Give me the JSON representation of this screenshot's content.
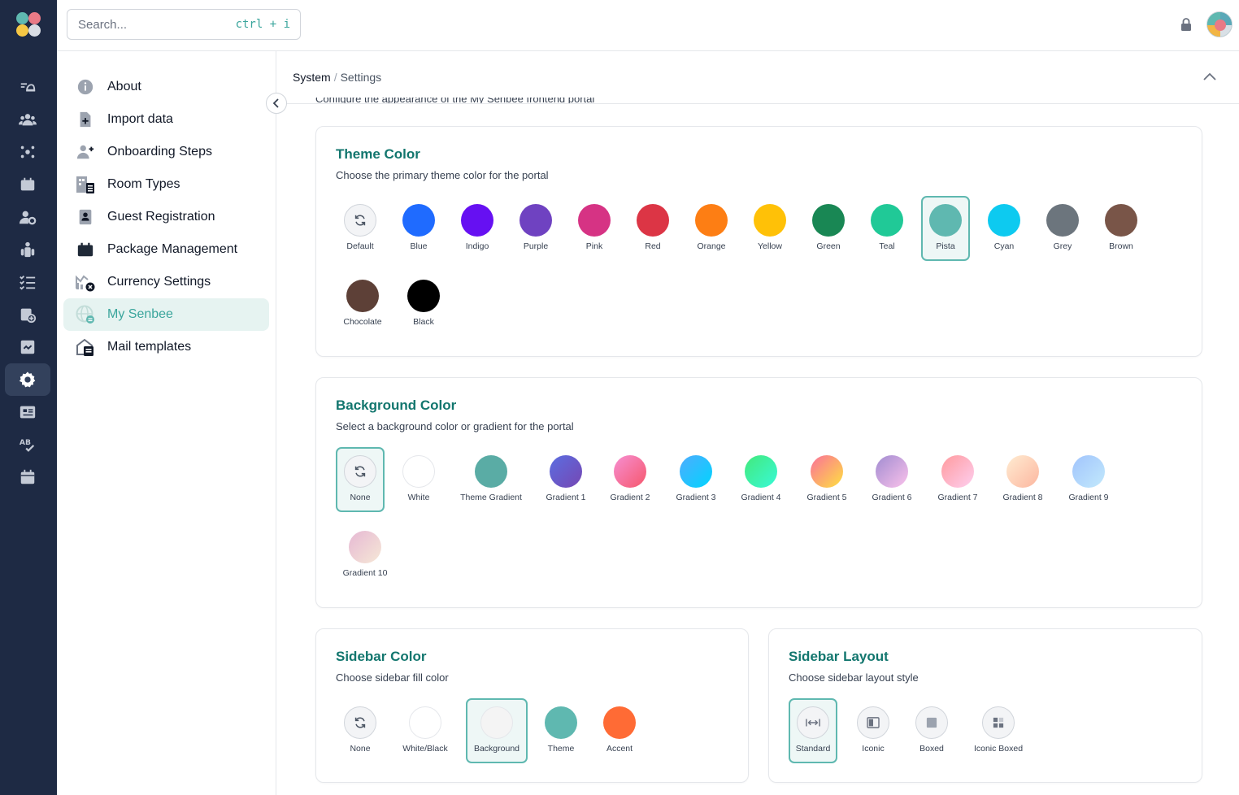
{
  "search": {
    "placeholder": "Search...",
    "shortcut": "ctrl + i"
  },
  "breadcrumb": {
    "parent": "System",
    "separator": "/",
    "current": "Settings"
  },
  "clipped_description": "Configure the appearance of the My Senbee frontend portal",
  "nav": [
    {
      "label": "About",
      "icon": "info-icon"
    },
    {
      "label": "Import data",
      "icon": "file-plus-icon"
    },
    {
      "label": "Onboarding Steps",
      "icon": "user-plus-icon"
    },
    {
      "label": "Room Types",
      "icon": "building-list-icon"
    },
    {
      "label": "Guest Registration",
      "icon": "id-card-icon"
    },
    {
      "label": "Package Management",
      "icon": "package-icon"
    },
    {
      "label": "Currency Settings",
      "icon": "currency-chart-icon"
    },
    {
      "label": "My Senbee",
      "icon": "globe-icon",
      "active": true
    },
    {
      "label": "Mail templates",
      "icon": "mail-template-icon"
    }
  ],
  "theme": {
    "title": "Theme Color",
    "subtitle": "Choose the primary theme color for the portal",
    "options": [
      {
        "name": "Default",
        "color": "reset"
      },
      {
        "name": "Blue",
        "color": "#1f6bff"
      },
      {
        "name": "Indigo",
        "color": "#6610f2"
      },
      {
        "name": "Purple",
        "color": "#6f42c1"
      },
      {
        "name": "Pink",
        "color": "#d63384"
      },
      {
        "name": "Red",
        "color": "#dc3545"
      },
      {
        "name": "Orange",
        "color": "#fd7e14"
      },
      {
        "name": "Yellow",
        "color": "#ffc107"
      },
      {
        "name": "Green",
        "color": "#198754"
      },
      {
        "name": "Teal",
        "color": "#20c997"
      },
      {
        "name": "Pista",
        "color": "#5fb8b0",
        "selected": true
      },
      {
        "name": "Cyan",
        "color": "#0dcaf0"
      },
      {
        "name": "Grey",
        "color": "#6c757d"
      },
      {
        "name": "Brown",
        "color": "#795548"
      },
      {
        "name": "Chocolate",
        "color": "#5d4037"
      },
      {
        "name": "Black",
        "color": "#000000"
      }
    ]
  },
  "background": {
    "title": "Background Color",
    "subtitle": "Select a background color or gradient for the portal",
    "options": [
      {
        "name": "None",
        "color": "reset",
        "selected": true
      },
      {
        "name": "White",
        "color": "#ffffff"
      },
      {
        "name": "Theme Gradient",
        "color": "#5aaca5"
      },
      {
        "name": "Gradient 1",
        "color": "linear-gradient(135deg,#5b6ee1,#7647b3)"
      },
      {
        "name": "Gradient 2",
        "color": "linear-gradient(135deg,#f78fd2,#f5576c)"
      },
      {
        "name": "Gradient 3",
        "color": "linear-gradient(135deg,#4facfe,#00d4fe)"
      },
      {
        "name": "Gradient 4",
        "color": "linear-gradient(135deg,#43e97b,#38f9d7)"
      },
      {
        "name": "Gradient 5",
        "color": "linear-gradient(135deg,#fa709a,#fee140)"
      },
      {
        "name": "Gradient 6",
        "color": "linear-gradient(135deg,#a18cd1,#fbc2eb)"
      },
      {
        "name": "Gradient 7",
        "color": "linear-gradient(135deg,#ff9a9e,#fecfef)"
      },
      {
        "name": "Gradient 8",
        "color": "linear-gradient(135deg,#ffecd2,#fcb69f)"
      },
      {
        "name": "Gradient 9",
        "color": "linear-gradient(135deg,#a1c4fd,#c2e9fb)"
      },
      {
        "name": "Gradient 10",
        "color": "linear-gradient(135deg,#e6b8d4,#f6e8d6)"
      }
    ]
  },
  "sidebar_color": {
    "title": "Sidebar Color",
    "subtitle": "Choose sidebar fill color",
    "options": [
      {
        "name": "None",
        "color": "reset"
      },
      {
        "name": "White/Black",
        "color": "#ffffff"
      },
      {
        "name": "Background",
        "color": "#f4f4f4",
        "selected": true
      },
      {
        "name": "Theme",
        "color": "#5fb8b0"
      },
      {
        "name": "Accent",
        "color": "#ff6b35"
      }
    ]
  },
  "sidebar_layout": {
    "title": "Sidebar Layout",
    "subtitle": "Choose sidebar layout style",
    "options": [
      {
        "name": "Standard",
        "icon": "arrows-horizontal-icon",
        "selected": true
      },
      {
        "name": "Iconic",
        "icon": "sidebar-iconic-icon"
      },
      {
        "name": "Boxed",
        "icon": "square-icon"
      },
      {
        "name": "Iconic Boxed",
        "icon": "grid-icon"
      }
    ]
  }
}
